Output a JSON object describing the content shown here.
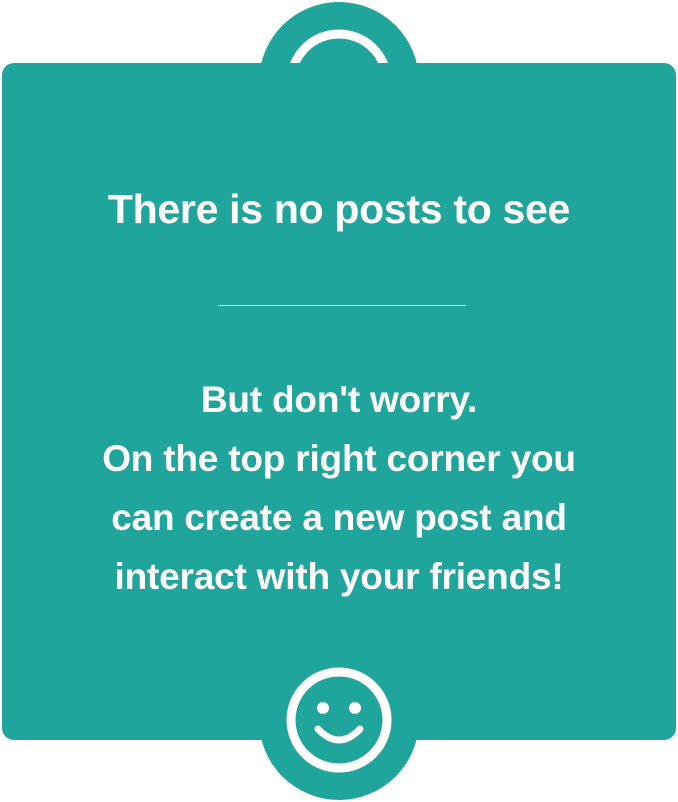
{
  "icons": {
    "top": "sad-face-icon",
    "bottom": "smiley-face-icon"
  },
  "colors": {
    "card_background": "#20a59c",
    "text": "#ffffff"
  },
  "empty_state": {
    "title": "There is no posts to see",
    "message_lines": [
      "But don't worry.",
      "On the top right corner you",
      "can create a new post and",
      "interact with your friends!"
    ]
  }
}
